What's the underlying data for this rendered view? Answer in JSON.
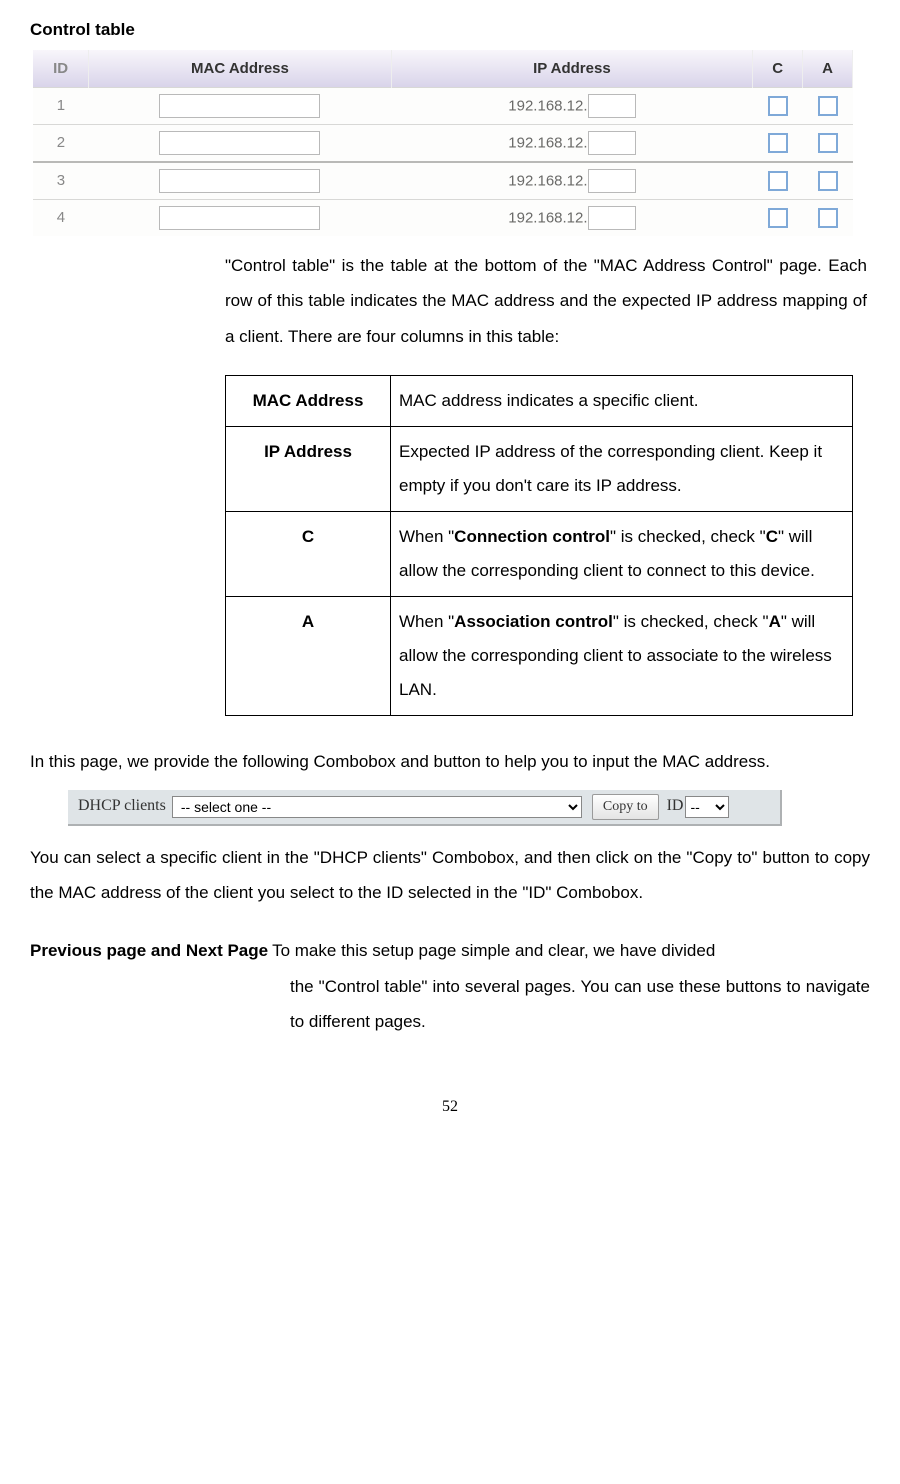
{
  "title": "Control table",
  "control_table": {
    "headers": {
      "id": "ID",
      "mac": "MAC Address",
      "ip": "IP Address",
      "c": "C",
      "a": "A"
    },
    "ip_prefix": "192.168.12.",
    "rows": [
      {
        "id": "1"
      },
      {
        "id": "2"
      },
      {
        "id": "3"
      },
      {
        "id": "4"
      }
    ]
  },
  "intro_paragraph": "\"Control table\" is the table at the bottom of the \"MAC Address Control\" page. Each row of this table indicates the MAC address and the expected IP address mapping of a client. There are four columns in this table:",
  "definitions": {
    "mac": {
      "label": "MAC Address",
      "desc": "MAC address indicates a specific client."
    },
    "ip": {
      "label": "IP Address",
      "desc": "Expected IP address of the corresponding client. Keep it empty if you don't care its IP address."
    },
    "c": {
      "label": "C",
      "pre": "When \"",
      "bold1": "Connection control",
      "mid": "\" is checked, check \"",
      "bold2": "C",
      "post": "\" will allow the corresponding client to connect to this device."
    },
    "a": {
      "label": "A",
      "pre": "When \"",
      "bold1": "Association control",
      "mid": "\" is checked, check \"",
      "bold2": "A",
      "post": "\" will allow the corresponding client to associate to the wireless LAN."
    }
  },
  "combobox_intro": "In this page, we provide the following Combobox and button to help you to input the MAC address.",
  "dhcp_bar": {
    "label": "DHCP clients",
    "select_placeholder": "-- select one --",
    "copy_btn": "Copy to",
    "id_label": "ID",
    "id_placeholder": "--"
  },
  "copy_explain": "You can select a specific client in the \"DHCP clients\" Combobox, and then click on the \"Copy to\" button to copy the MAC address of the client you select to the ID selected in the \"ID\" Combobox.",
  "nav": {
    "lead": "Previous page and Next Page",
    "line1_rest": "To make this setup page simple and clear, we have divided",
    "rest": "the \"Control table\" into several pages. You can use these buttons to navigate to different pages."
  },
  "page_number": "52"
}
